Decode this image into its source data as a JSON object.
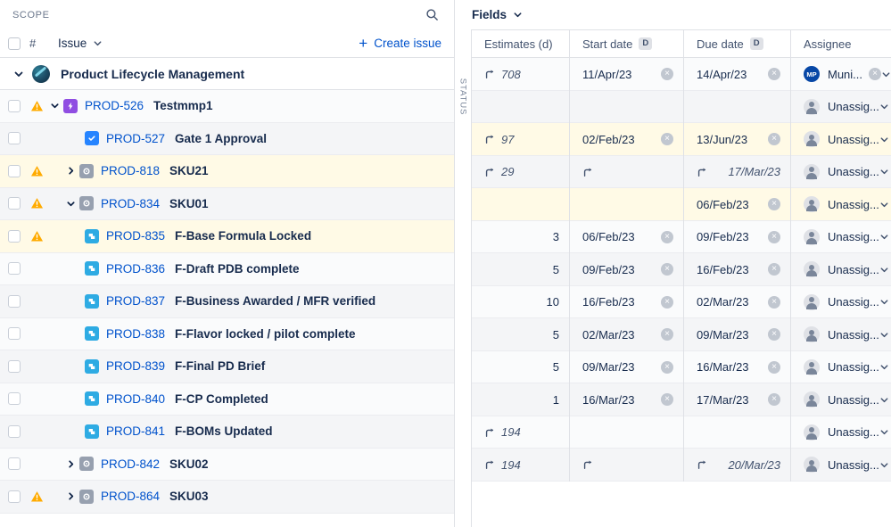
{
  "scope": {
    "panel_label": "SCOPE",
    "search_icon": "search-icon",
    "header": {
      "hash": "#",
      "issue_label": "Issue",
      "create_label": "Create issue"
    },
    "epic_group": {
      "title": "Product Lifecycle Management"
    },
    "rows": [
      {
        "key": "PROD-526",
        "summary": "Testmmp1",
        "type": "epic",
        "indent": 0,
        "warn": true,
        "chevron": "down",
        "bg": "plain"
      },
      {
        "key": "PROD-527",
        "summary": "Gate 1 Approval",
        "type": "task",
        "indent": 2,
        "warn": false,
        "chevron": "none",
        "bg": "alt"
      },
      {
        "key": "PROD-818",
        "summary": "SKU21",
        "type": "sku",
        "indent": 1,
        "warn": true,
        "chevron": "right",
        "bg": "warn"
      },
      {
        "key": "PROD-834",
        "summary": "SKU01",
        "type": "sku",
        "indent": 1,
        "warn": true,
        "chevron": "down",
        "bg": "alt"
      },
      {
        "key": "PROD-835",
        "summary": "F-Base Formula Locked",
        "type": "story",
        "indent": 2,
        "warn": true,
        "chevron": "none",
        "bg": "warn"
      },
      {
        "key": "PROD-836",
        "summary": "F-Draft PDB complete",
        "type": "story",
        "indent": 2,
        "warn": false,
        "chevron": "none",
        "bg": "plain"
      },
      {
        "key": "PROD-837",
        "summary": "F-Business Awarded / MFR verified",
        "type": "story",
        "indent": 2,
        "warn": false,
        "chevron": "none",
        "bg": "alt"
      },
      {
        "key": "PROD-838",
        "summary": "F-Flavor locked / pilot complete",
        "type": "story",
        "indent": 2,
        "warn": false,
        "chevron": "none",
        "bg": "plain"
      },
      {
        "key": "PROD-839",
        "summary": "F-Final PD Brief",
        "type": "story",
        "indent": 2,
        "warn": false,
        "chevron": "none",
        "bg": "alt"
      },
      {
        "key": "PROD-840",
        "summary": "F-CP Completed",
        "type": "story",
        "indent": 2,
        "warn": false,
        "chevron": "none",
        "bg": "plain"
      },
      {
        "key": "PROD-841",
        "summary": "F-BOMs Updated",
        "type": "story",
        "indent": 2,
        "warn": false,
        "chevron": "none",
        "bg": "alt"
      },
      {
        "key": "PROD-842",
        "summary": "SKU02",
        "type": "sku",
        "indent": 1,
        "warn": false,
        "chevron": "right",
        "bg": "plain"
      },
      {
        "key": "PROD-864",
        "summary": "SKU03",
        "type": "sku",
        "indent": 1,
        "warn": true,
        "chevron": "right",
        "bg": "alt"
      }
    ]
  },
  "fields": {
    "menu_label": "Fields",
    "status_rail_label": "STATUS",
    "columns": [
      {
        "label": "Estimates (d)",
        "badge": ""
      },
      {
        "label": "Start date",
        "badge": "D"
      },
      {
        "label": "Due date",
        "badge": "D"
      },
      {
        "label": "Assignee",
        "badge": ""
      }
    ],
    "rows": [
      {
        "estimate": "708",
        "estimate_rollup": true,
        "start": "11/Apr/23",
        "start_rollup": false,
        "due": "14/Apr/23",
        "due_rollup": false,
        "assignee": "Muni...",
        "avatar": "MP",
        "assignee_clear": true,
        "bg": "plain"
      },
      {
        "estimate": "",
        "estimate_rollup": false,
        "start": "",
        "start_rollup": false,
        "due": "",
        "due_rollup": false,
        "assignee": "Unassig...",
        "avatar": "",
        "assignee_clear": false,
        "bg": "alt"
      },
      {
        "estimate": "97",
        "estimate_rollup": true,
        "start": "02/Feb/23",
        "start_rollup": false,
        "due": "13/Jun/23",
        "due_rollup": false,
        "assignee": "Unassig...",
        "avatar": "",
        "assignee_clear": false,
        "bg": "warn"
      },
      {
        "estimate": "29",
        "estimate_rollup": true,
        "start": "",
        "start_rollup": true,
        "due": "17/Mar/23",
        "due_rollup": true,
        "assignee": "Unassig...",
        "avatar": "",
        "assignee_clear": false,
        "bg": "alt"
      },
      {
        "estimate": "",
        "estimate_rollup": false,
        "start": "",
        "start_rollup": false,
        "due": "06/Feb/23",
        "due_rollup": false,
        "assignee": "Unassig...",
        "avatar": "",
        "assignee_clear": false,
        "bg": "warn"
      },
      {
        "estimate": "3",
        "estimate_rollup": false,
        "start": "06/Feb/23",
        "start_rollup": false,
        "due": "09/Feb/23",
        "due_rollup": false,
        "assignee": "Unassig...",
        "avatar": "",
        "assignee_clear": false,
        "bg": "plain"
      },
      {
        "estimate": "5",
        "estimate_rollup": false,
        "start": "09/Feb/23",
        "start_rollup": false,
        "due": "16/Feb/23",
        "due_rollup": false,
        "assignee": "Unassig...",
        "avatar": "",
        "assignee_clear": false,
        "bg": "alt"
      },
      {
        "estimate": "10",
        "estimate_rollup": false,
        "start": "16/Feb/23",
        "start_rollup": false,
        "due": "02/Mar/23",
        "due_rollup": false,
        "assignee": "Unassig...",
        "avatar": "",
        "assignee_clear": false,
        "bg": "plain"
      },
      {
        "estimate": "5",
        "estimate_rollup": false,
        "start": "02/Mar/23",
        "start_rollup": false,
        "due": "09/Mar/23",
        "due_rollup": false,
        "assignee": "Unassig...",
        "avatar": "",
        "assignee_clear": false,
        "bg": "alt"
      },
      {
        "estimate": "5",
        "estimate_rollup": false,
        "start": "09/Mar/23",
        "start_rollup": false,
        "due": "16/Mar/23",
        "due_rollup": false,
        "assignee": "Unassig...",
        "avatar": "",
        "assignee_clear": false,
        "bg": "plain"
      },
      {
        "estimate": "1",
        "estimate_rollup": false,
        "start": "16/Mar/23",
        "start_rollup": false,
        "due": "17/Mar/23",
        "due_rollup": false,
        "assignee": "Unassig...",
        "avatar": "",
        "assignee_clear": false,
        "bg": "alt"
      },
      {
        "estimate": "194",
        "estimate_rollup": true,
        "start": "",
        "start_rollup": false,
        "due": "",
        "due_rollup": false,
        "assignee": "Unassig...",
        "avatar": "",
        "assignee_clear": false,
        "bg": "plain"
      },
      {
        "estimate": "194",
        "estimate_rollup": true,
        "start": "",
        "start_rollup": true,
        "due": "20/Mar/23",
        "due_rollup": true,
        "assignee": "Unassig...",
        "avatar": "",
        "assignee_clear": false,
        "bg": "alt"
      }
    ]
  },
  "colors": {
    "link": "#0052cc",
    "warn_row": "#fffae6",
    "warn_icon": "#ffab00",
    "epic_icon": "#904ee2",
    "task_icon": "#2684ff",
    "sku_icon": "#97a0af",
    "story_icon": "#2eabe3",
    "avatar_mp": "#0747a6"
  }
}
